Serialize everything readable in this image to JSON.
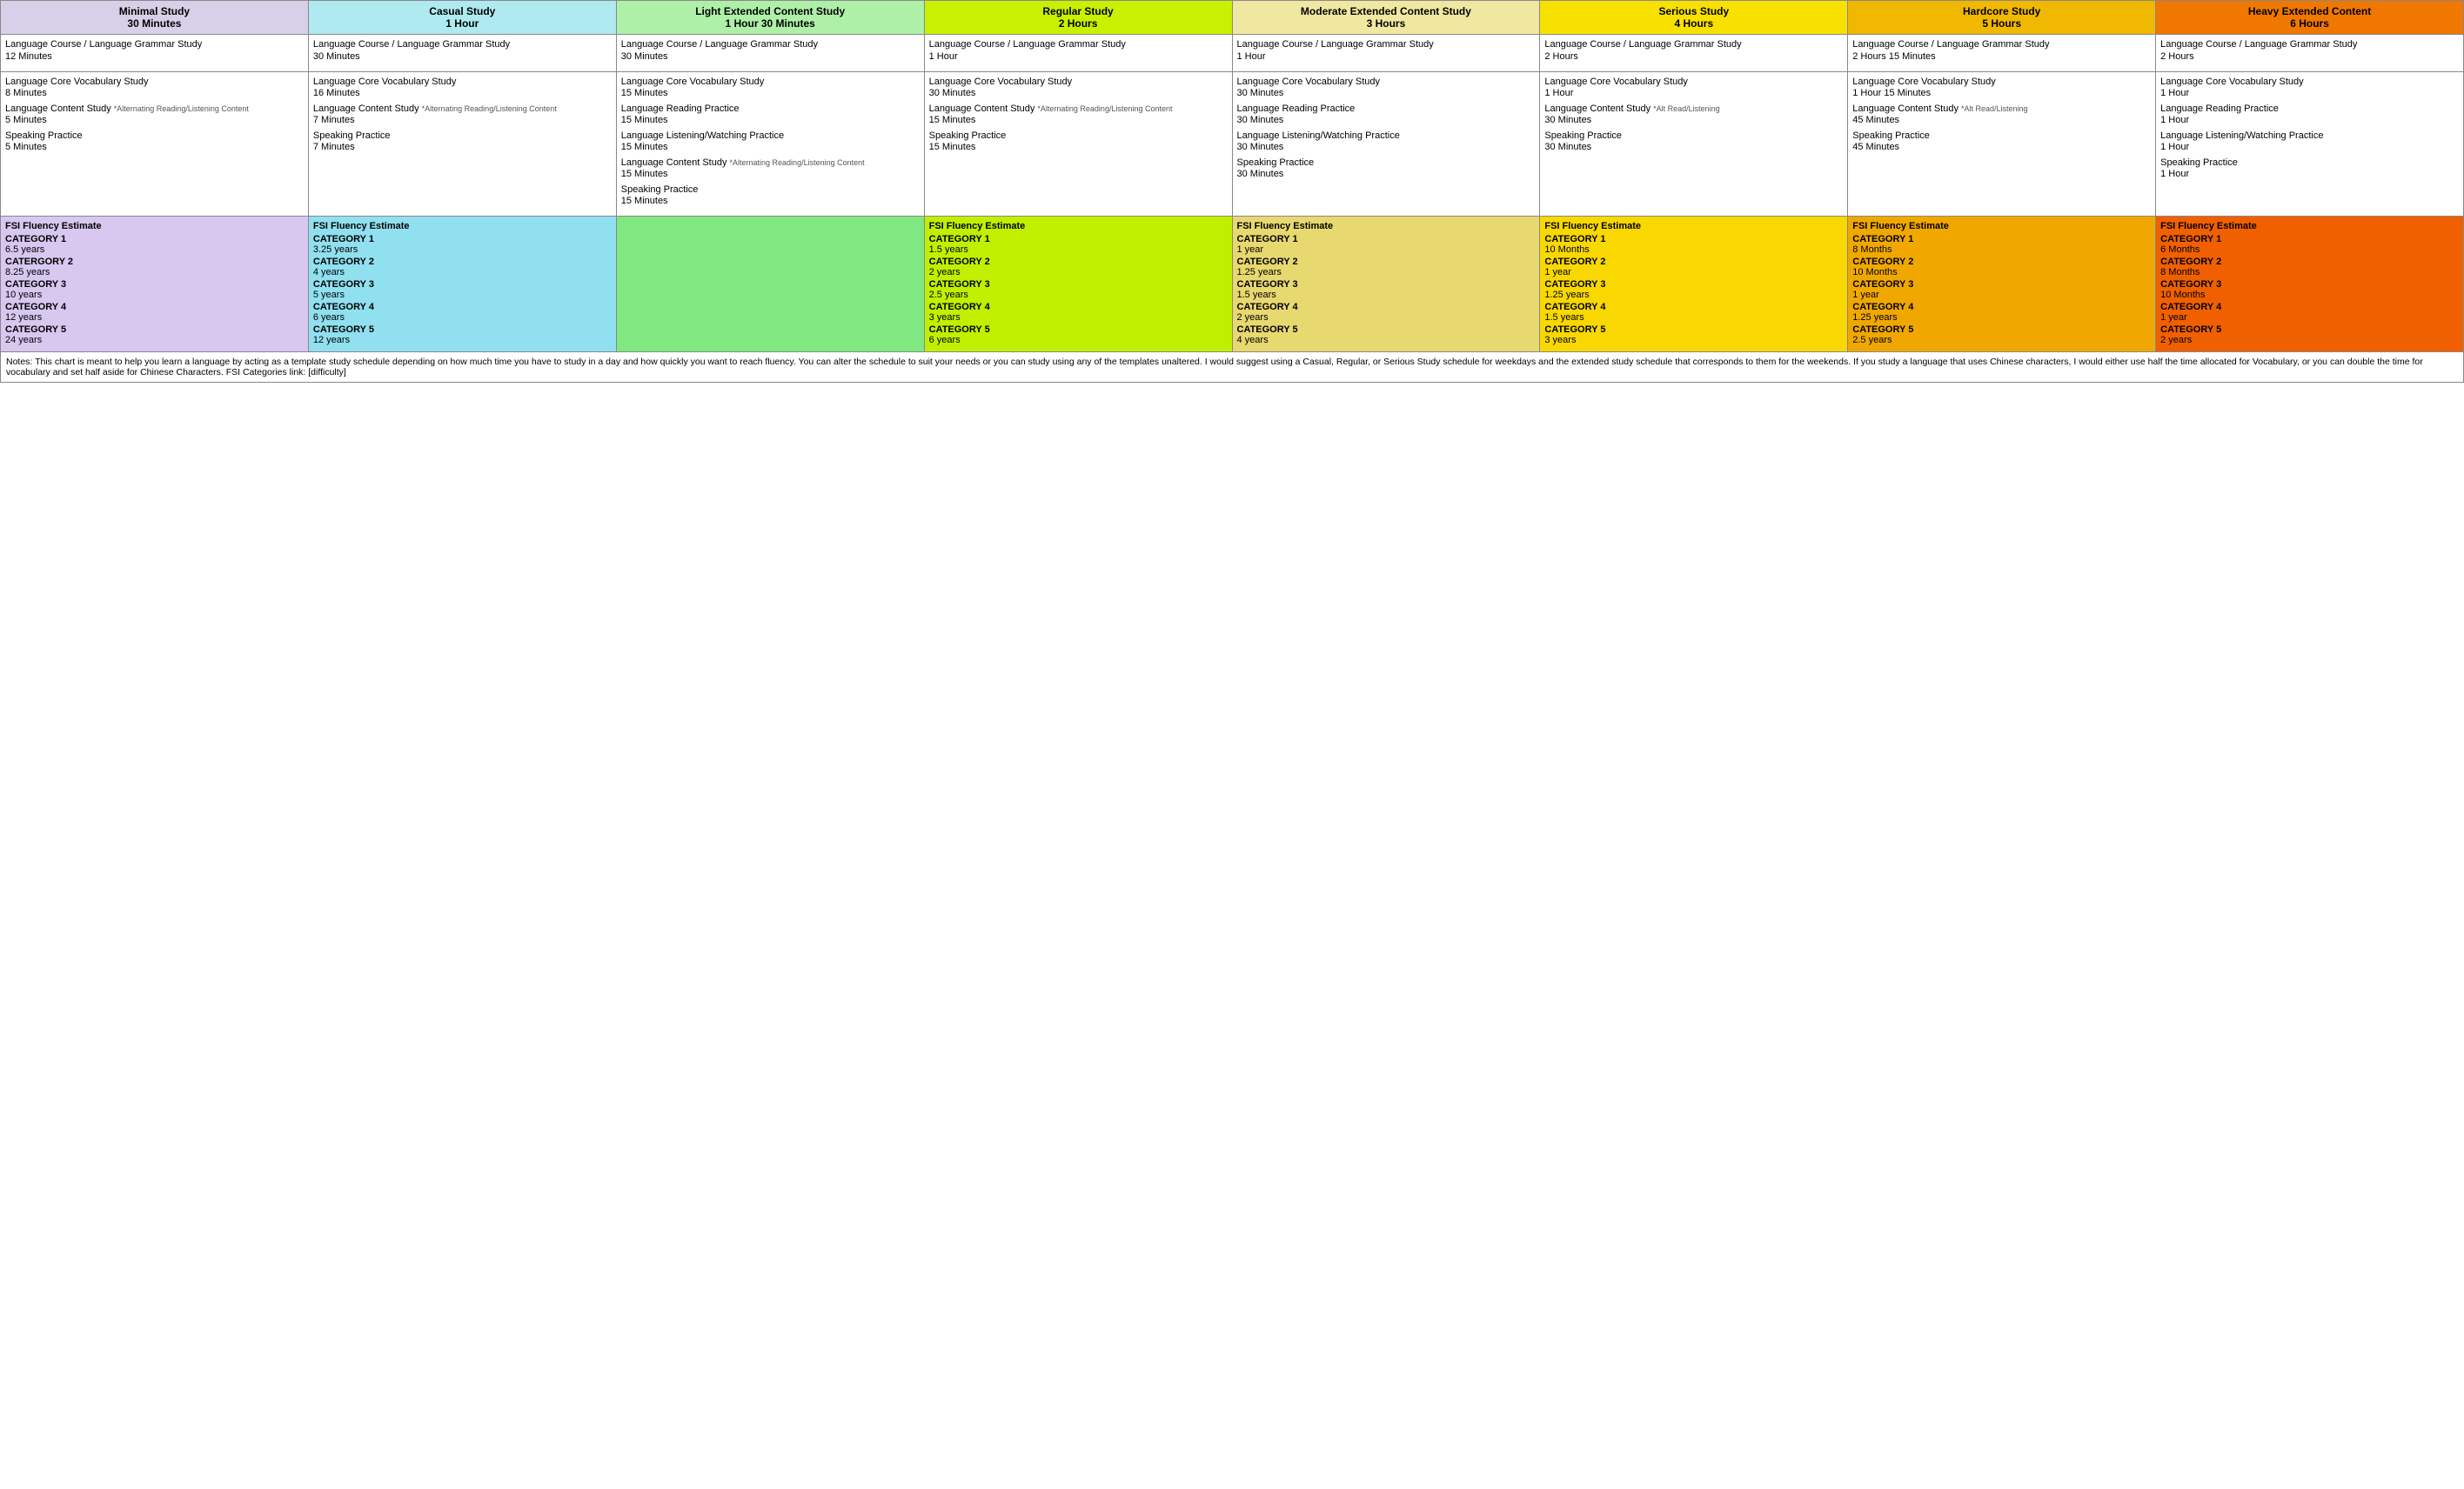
{
  "columns": [
    {
      "id": "minimal",
      "colorClass": "col-minimal",
      "title": "Minimal Study",
      "duration": "30 Minutes"
    },
    {
      "id": "casual",
      "colorClass": "col-casual",
      "title": "Casual Study",
      "duration": "1 Hour"
    },
    {
      "id": "light",
      "colorClass": "col-light",
      "title": "Light Extended Content Study",
      "duration": "1 Hour 30 Minutes"
    },
    {
      "id": "regular",
      "colorClass": "col-regular",
      "title": "Regular Study",
      "duration": "2 Hours"
    },
    {
      "id": "moderate",
      "colorClass": "col-moderate",
      "title": "Moderate Extended Content Study",
      "duration": "3 Hours"
    },
    {
      "id": "serious",
      "colorClass": "col-serious",
      "title": "Serious Study",
      "duration": "4 Hours"
    },
    {
      "id": "hardcore",
      "colorClass": "col-hardcore",
      "title": "Hardcore Study",
      "duration": "5 Hours"
    },
    {
      "id": "heavy",
      "colorClass": "col-heavy",
      "title": "Heavy Extended Content",
      "duration": "6 Hours"
    }
  ],
  "rows": [
    {
      "cells": [
        {
          "activities": [
            {
              "name": "Language Course / Language Grammar Study",
              "time": "12 Minutes"
            }
          ]
        },
        {
          "activities": [
            {
              "name": "Language Course / Language Grammar Study",
              "time": "30 Minutes"
            }
          ]
        },
        {
          "activities": [
            {
              "name": "Language Course / Language Grammar Study",
              "time": "30 Minutes"
            }
          ]
        },
        {
          "activities": [
            {
              "name": "Language Course / Language Grammar Study",
              "time": "1 Hour"
            }
          ]
        },
        {
          "activities": [
            {
              "name": "Language Course / Language Grammar Study",
              "time": "1 Hour"
            }
          ]
        },
        {
          "activities": [
            {
              "name": "Language Course / Language Grammar Study",
              "time": "2 Hours"
            }
          ]
        },
        {
          "activities": [
            {
              "name": "Language Course / Language Grammar Study",
              "time": "2 Hours 15 Minutes"
            }
          ]
        },
        {
          "activities": [
            {
              "name": "Language Course / Language Grammar Study",
              "time": "2 Hours"
            }
          ]
        }
      ]
    },
    {
      "cells": [
        {
          "activities": [
            {
              "name": "Language Core Vocabulary Study",
              "time": "8 Minutes"
            },
            {
              "name": "Language Content Study",
              "note": "*Alternating Reading/Listening Content",
              "time": "5 Minutes"
            },
            {
              "name": "Speaking Practice",
              "time": "5 Minutes"
            }
          ]
        },
        {
          "activities": [
            {
              "name": "Language Core Vocabulary Study",
              "time": "16 Minutes"
            },
            {
              "name": "Language Content Study",
              "note": "*Alternating Reading/Listening Content",
              "time": "7 Minutes"
            },
            {
              "name": "Speaking Practice",
              "time": "7 Minutes"
            }
          ]
        },
        {
          "activities": [
            {
              "name": "Language Core Vocabulary Study",
              "time": "15 Minutes"
            },
            {
              "name": "Language Reading Practice",
              "time": "15 Minutes"
            },
            {
              "name": "Language Listening/Watching Practice",
              "time": "15 Minutes"
            },
            {
              "name": "Language Content Study",
              "note": "*Alternating Reading/Listening Content",
              "time": "15 Minutes"
            },
            {
              "name": "Speaking Practice",
              "time": "15 Minutes"
            }
          ]
        },
        {
          "activities": [
            {
              "name": "Language Core Vocabulary Study",
              "time": "30 Minutes"
            },
            {
              "name": "Language Content Study",
              "note": "*Alternating Reading/Listening Content",
              "time": "15 Minutes"
            },
            {
              "name": "Speaking Practice",
              "time": "15 Minutes"
            }
          ]
        },
        {
          "activities": [
            {
              "name": "Language Core Vocabulary Study",
              "time": "30 Minutes"
            },
            {
              "name": "Language Reading Practice",
              "time": "30 Minutes"
            },
            {
              "name": "Language Listening/Watching Practice",
              "time": "30 Minutes"
            },
            {
              "name": "Speaking Practice",
              "time": "30 Minutes"
            }
          ]
        },
        {
          "activities": [
            {
              "name": "Language Core Vocabulary Study",
              "time": "1 Hour"
            },
            {
              "name": "Language Content Study",
              "note": "*Alt Read/Listening",
              "time": "30 Minutes"
            },
            {
              "name": "Speaking Practice",
              "time": "30 Minutes"
            }
          ]
        },
        {
          "activities": [
            {
              "name": "Language Core Vocabulary Study",
              "time": "1 Hour 15 Minutes"
            },
            {
              "name": "Language Content Study",
              "note": "*Alt Read/Listening",
              "time": "45 Minutes"
            },
            {
              "name": "Speaking Practice",
              "time": "45 Minutes"
            }
          ]
        },
        {
          "activities": [
            {
              "name": "Language Core Vocabulary Study",
              "time": "1 Hour"
            },
            {
              "name": "Language Reading Practice",
              "time": "1 Hour"
            },
            {
              "name": "Language Listening/Watching Practice",
              "time": "1 Hour"
            },
            {
              "name": "Speaking Practice",
              "time": "1 Hour"
            }
          ]
        }
      ]
    }
  ],
  "fluency": [
    {
      "colId": "minimal",
      "colorClass": "fluency-minimal",
      "label": "FSI Fluency Estimate",
      "entries": [
        {
          "cat": "CATEGORY 1",
          "val": "6.5 years"
        },
        {
          "cat": "CATERGORY 2",
          "val": "8.25 years"
        },
        {
          "cat": "CATEGORY 3",
          "val": "10 years"
        },
        {
          "cat": "CATEGORY 4",
          "val": "12 years"
        },
        {
          "cat": "CATEGORY 5",
          "val": "24 years"
        }
      ]
    },
    {
      "colId": "casual",
      "colorClass": "fluency-casual",
      "label": "FSI Fluency Estimate",
      "entries": [
        {
          "cat": "CATEGORY 1",
          "val": "3.25 years"
        },
        {
          "cat": "CATEGORY 2",
          "val": "4 years"
        },
        {
          "cat": "CATEGORY 3",
          "val": "5 years"
        },
        {
          "cat": "CATEGORY 4",
          "val": "6 years"
        },
        {
          "cat": "CATEGORY 5",
          "val": "12 years"
        }
      ]
    },
    {
      "colId": "light",
      "colorClass": "fluency-light",
      "label": "",
      "entries": []
    },
    {
      "colId": "regular",
      "colorClass": "fluency-regular",
      "label": "FSI Fluency Estimate",
      "entries": [
        {
          "cat": "CATEGORY 1",
          "val": "1.5 years"
        },
        {
          "cat": "CATEGORY 2",
          "val": "2 years"
        },
        {
          "cat": "CATEGORY 3",
          "val": "2.5 years"
        },
        {
          "cat": "CATEGORY 4",
          "val": "3 years"
        },
        {
          "cat": "CATEGORY 5",
          "val": "6 years"
        }
      ]
    },
    {
      "colId": "moderate",
      "colorClass": "fluency-moderate",
      "label": "FSI Fluency Estimate",
      "entries": [
        {
          "cat": "CATEGORY 1",
          "val": "1 year"
        },
        {
          "cat": "CATEGORY 2",
          "val": "1.25 years"
        },
        {
          "cat": "CATEGORY 3",
          "val": "1.5 years"
        },
        {
          "cat": "CATEGORY 4",
          "val": "2 years"
        },
        {
          "cat": "CATEGORY 5",
          "val": "4 years"
        }
      ]
    },
    {
      "colId": "serious",
      "colorClass": "fluency-serious",
      "label": "FSI Fluency Estimate",
      "entries": [
        {
          "cat": "CATEGORY 1",
          "val": "10 Months"
        },
        {
          "cat": "CATEGORY 2",
          "val": "1 year"
        },
        {
          "cat": "CATEGORY 3",
          "val": "1.25 years"
        },
        {
          "cat": "CATEGORY 4",
          "val": "1.5 years"
        },
        {
          "cat": "CATEGORY 5",
          "val": "3 years"
        }
      ]
    },
    {
      "colId": "hardcore",
      "colorClass": "fluency-hardcore",
      "label": "FSI Fluency Estimate",
      "entries": [
        {
          "cat": "CATEGORY 1",
          "val": "8 Months"
        },
        {
          "cat": "CATEGORY 2",
          "val": "10 Months"
        },
        {
          "cat": "CATEGORY 3",
          "val": "1 year"
        },
        {
          "cat": "CATEGORY 4",
          "val": "1.25 years"
        },
        {
          "cat": "CATEGORY 5",
          "val": "2.5 years"
        }
      ]
    },
    {
      "colId": "heavy",
      "colorClass": "fluency-heavy",
      "label": "FSI Fluency Estimate",
      "entries": [
        {
          "cat": "CATEGORY 1",
          "val": "6 Months"
        },
        {
          "cat": "CATEGORY 2",
          "val": "8 Months"
        },
        {
          "cat": "CATEGORY 3",
          "val": "10 Months"
        },
        {
          "cat": "CATEGORY 4",
          "val": "1 year"
        },
        {
          "cat": "CATEGORY 5",
          "val": "2 years"
        }
      ]
    }
  ],
  "notes": "Notes: This chart is meant to help you learn a language by acting as a template study schedule depending on how much time you have to study in a day and how quickly you want to reach fluency. You can alter the schedule to suit your needs or you can study using any of the templates unaltered. I would suggest using a Casual, Regular, or Serious Study schedule for weekdays and the extended study schedule that corresponds to them for the weekends. If you study a language that uses Chinese characters, I would either use half the time allocated for Vocabulary, or you can double the time for vocabulary and set half aside for Chinese Characters. FSI Categories link: [difficulty]"
}
